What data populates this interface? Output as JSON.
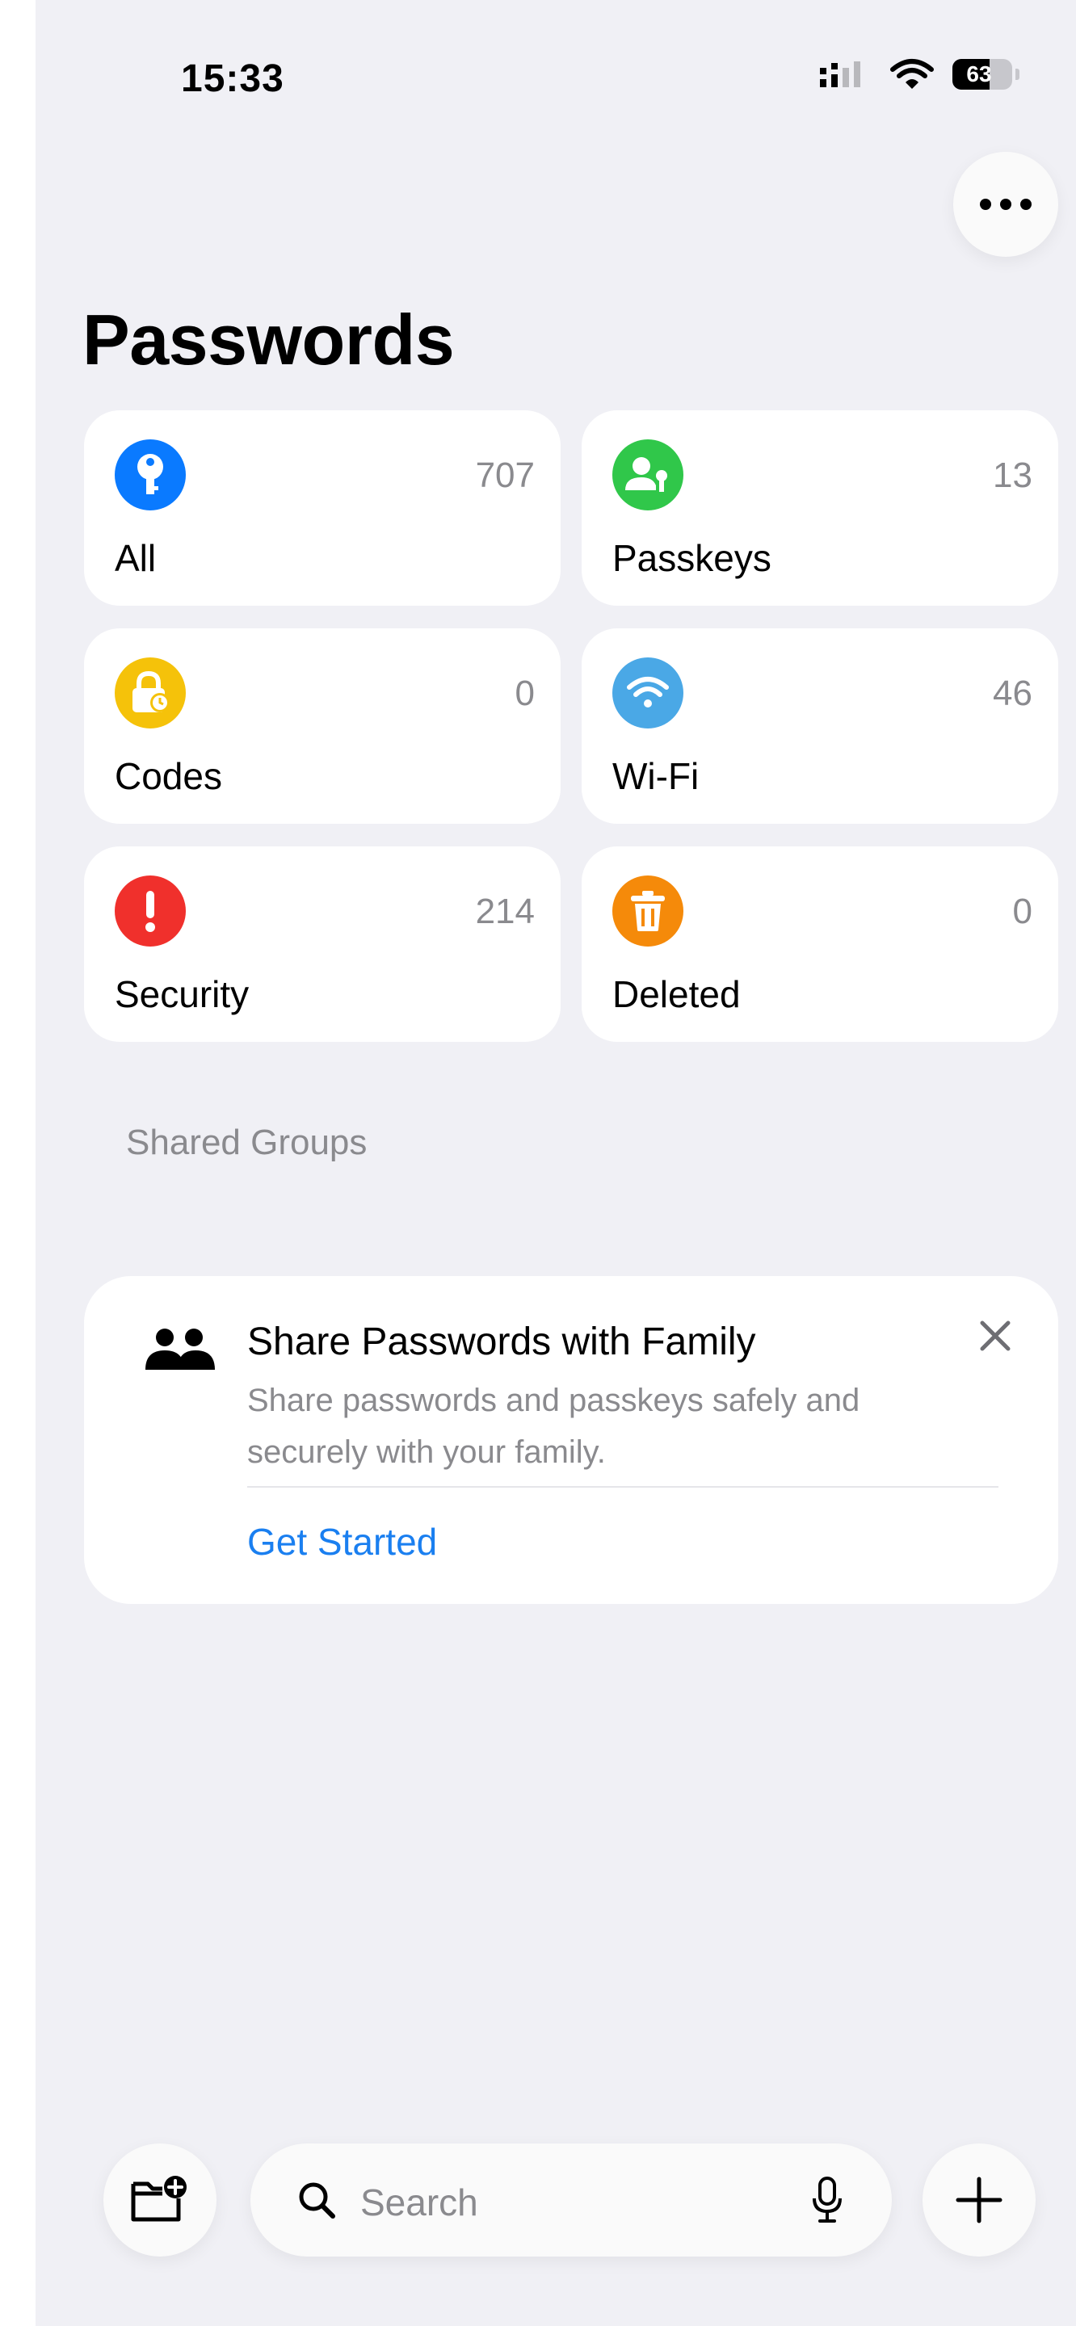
{
  "status_bar": {
    "time": "15:33",
    "battery_level": "63"
  },
  "header": {
    "title": "Passwords",
    "more_icon": "ellipsis-icon"
  },
  "categories": [
    {
      "label": "All",
      "count": "707",
      "icon": "key-icon",
      "color": "#0a7aff"
    },
    {
      "label": "Passkeys",
      "count": "13",
      "icon": "passkey-person-icon",
      "color": "#30c74a"
    },
    {
      "label": "Codes",
      "count": "0",
      "icon": "lock-clock-icon",
      "color": "#f5c20a"
    },
    {
      "label": "Wi-Fi",
      "count": "46",
      "icon": "wifi-icon",
      "color": "#4aa8e6"
    },
    {
      "label": "Security",
      "count": "214",
      "icon": "exclamation-icon",
      "color": "#f0302c"
    },
    {
      "label": "Deleted",
      "count": "0",
      "icon": "trash-icon",
      "color": "#f58a0a"
    }
  ],
  "shared_groups": {
    "header": "Shared Groups"
  },
  "family_card": {
    "title": "Share Passwords with Family",
    "description": "Share passwords and passkeys safely and securely with your family.",
    "action": "Get Started",
    "icon": "people-icon",
    "close_icon": "close-icon",
    "accent": "#1a7ff0"
  },
  "toolbar": {
    "search_placeholder": "Search",
    "new_folder_icon": "folder-add-icon",
    "search_icon": "search-icon",
    "mic_icon": "microphone-icon",
    "add_icon": "plus-icon"
  }
}
